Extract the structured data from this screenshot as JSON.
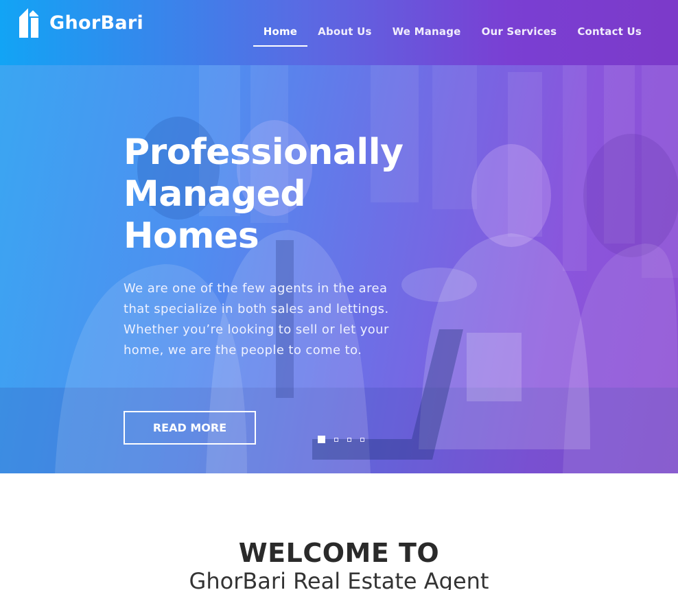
{
  "brand": {
    "name": "GhorBari",
    "logo_icon": "house-icon"
  },
  "nav": {
    "items": [
      {
        "label": "Home",
        "active": true
      },
      {
        "label": "About Us"
      },
      {
        "label": "We Manage"
      },
      {
        "label": "Our Services"
      },
      {
        "label": "Contact Us"
      }
    ]
  },
  "hero": {
    "title_lines": [
      "Professionally",
      "Managed",
      "Homes"
    ],
    "description": "We are one of the few agents in the area that specialize in both sales and lettings. Whether you’re looking to sell or let your home, we are the people to come to.",
    "button_label": "READ MORE",
    "slides": {
      "count": 4,
      "active_index": 0
    },
    "background_image": "business-handshake-meeting-photo"
  },
  "welcome": {
    "title": "WELCOME TO",
    "subtitle": "GhorBari Real Estate Agent"
  },
  "colors": {
    "header_gradient_start": "#12a4f5",
    "header_gradient_end": "#7c3ac9",
    "hero_overlay_start": "#3aa6f2",
    "hero_overlay_end": "#8e4fd3"
  }
}
